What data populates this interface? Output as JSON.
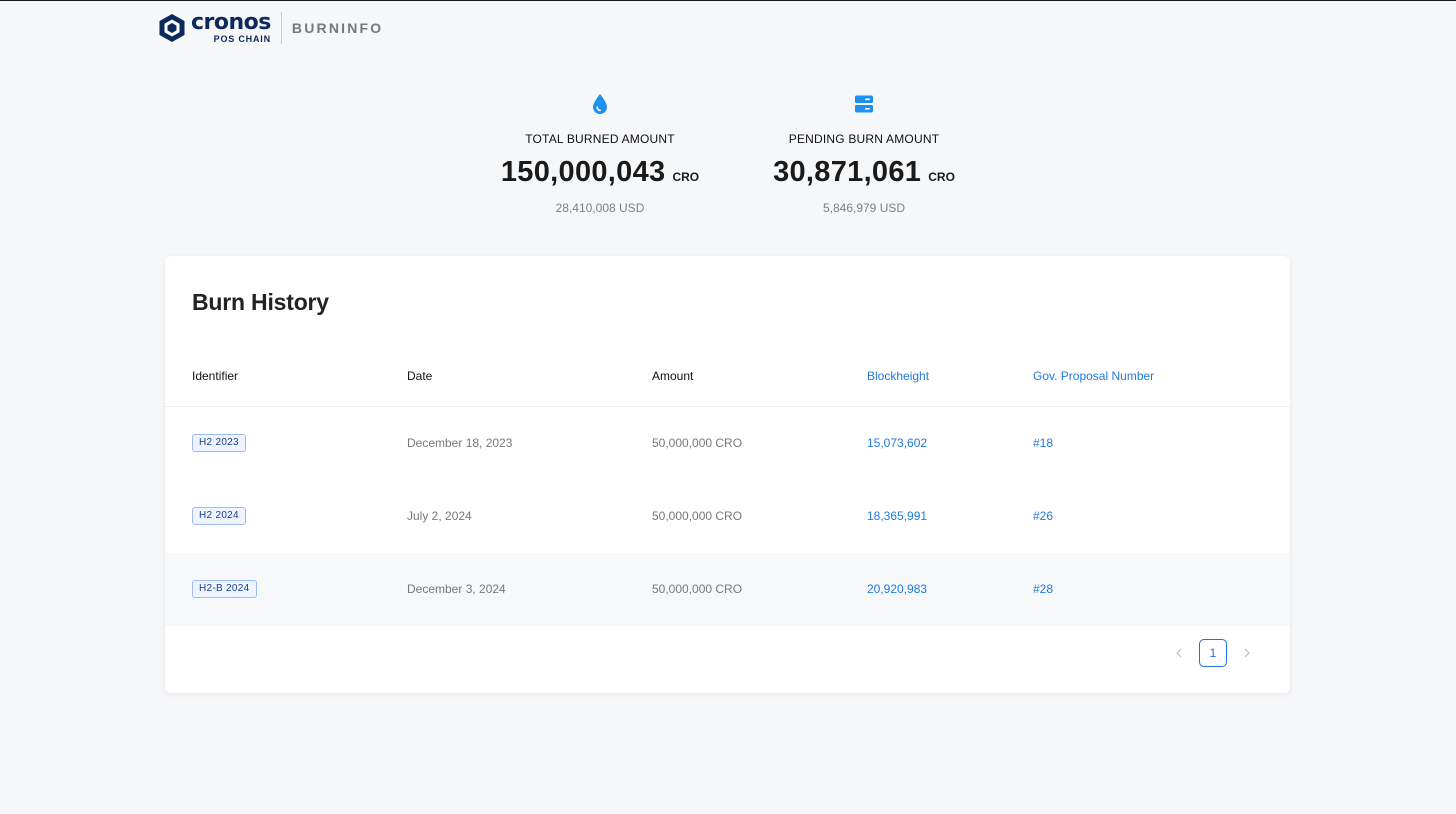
{
  "header": {
    "logo_word": "cronos",
    "logo_sub": "POS CHAIN",
    "site_name": "BURNINFO"
  },
  "stats": {
    "total": {
      "icon": "drop-icon",
      "label": "TOTAL BURNED AMOUNT",
      "value": "150,000,043",
      "unit": "CRO",
      "usd": "28,410,008 USD"
    },
    "pending": {
      "icon": "server-icon",
      "label": "PENDING BURN AMOUNT",
      "value": "30,871,061",
      "unit": "CRO",
      "usd": "5,846,979 USD"
    }
  },
  "history": {
    "title": "Burn History",
    "columns": {
      "identifier": "Identifier",
      "date": "Date",
      "amount": "Amount",
      "blockheight": "Blockheight",
      "gov": "Gov. Proposal Number"
    },
    "rows": [
      {
        "identifier": "H2 2023",
        "date": "December 18, 2023",
        "amount": "50,000,000 CRO",
        "blockheight": "15,073,602",
        "gov": "#18"
      },
      {
        "identifier": "H2 2024",
        "date": "July 2, 2024",
        "amount": "50,000,000 CRO",
        "blockheight": "18,365,991",
        "gov": "#26"
      },
      {
        "identifier": "H2-B 2024",
        "date": "December 3, 2024",
        "amount": "50,000,000 CRO",
        "blockheight": "20,920,983",
        "gov": "#28"
      }
    ]
  },
  "pagination": {
    "current_page": "1",
    "prev_icon": "chevron-left-icon",
    "next_icon": "chevron-right-icon"
  },
  "colors": {
    "accent": "#1f7ae0",
    "brand_navy": "#0b2a5b",
    "icon_blue": "#1e90f0",
    "background": "#f6f7f9"
  }
}
